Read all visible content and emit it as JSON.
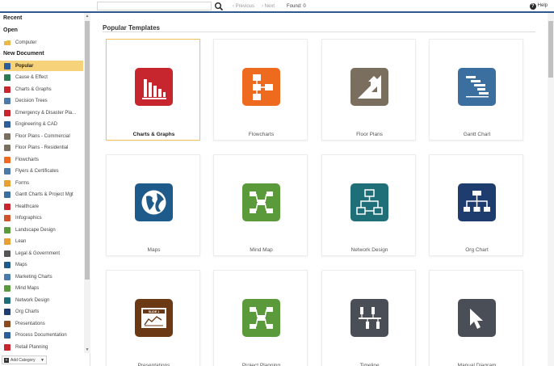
{
  "topbar": {
    "search_value": "",
    "prev_label": "Previous",
    "next_label": "Next",
    "found_label": "Found: 0",
    "help_label": "Help"
  },
  "sidebar": {
    "recent_label": "Recent",
    "open_label": "Open",
    "computer_label": "Computer",
    "new_document_label": "New Document",
    "items": [
      {
        "label": "Popular",
        "color": "#2e5e9a",
        "active": true
      },
      {
        "label": "Cause & Effect",
        "color": "#2b7a55"
      },
      {
        "label": "Charts & Graphs",
        "color": "#c8262e"
      },
      {
        "label": "Decision Trees",
        "color": "#4a7aa7"
      },
      {
        "label": "Emergency & Disaster Pla...",
        "color": "#c8262e"
      },
      {
        "label": "Engineering & CAD",
        "color": "#2e5e9a"
      },
      {
        "label": "Floor Plans - Commercial",
        "color": "#7a6e5e"
      },
      {
        "label": "Floor Plans - Residential",
        "color": "#7a6e5e"
      },
      {
        "label": "Flowcharts",
        "color": "#ee6a1f"
      },
      {
        "label": "Flyers & Certificates",
        "color": "#4a7aa7"
      },
      {
        "label": "Forms",
        "color": "#e8a030"
      },
      {
        "label": "Gantt Charts & Project Mgt",
        "color": "#3a6fa0"
      },
      {
        "label": "Healthcare",
        "color": "#c8262e"
      },
      {
        "label": "Infographics",
        "color": "#d0542a"
      },
      {
        "label": "Landscape Design",
        "color": "#5a9a3a"
      },
      {
        "label": "Lean",
        "color": "#e8a030"
      },
      {
        "label": "Legal & Government",
        "color": "#555555"
      },
      {
        "label": "Maps",
        "color": "#1f5b8a"
      },
      {
        "label": "Marketing Charts",
        "color": "#4a7aa7"
      },
      {
        "label": "Mind Maps",
        "color": "#5a9a3a"
      },
      {
        "label": "Network Design",
        "color": "#1f6f78"
      },
      {
        "label": "Org Charts",
        "color": "#1e3d6e"
      },
      {
        "label": "Presentations",
        "color": "#8a4a1e"
      },
      {
        "label": "Process Documentation",
        "color": "#2e5e9a"
      },
      {
        "label": "Retail Planning",
        "color": "#c8262e"
      }
    ],
    "add_category_label": "Add Category"
  },
  "main": {
    "section_title": "Popular Templates",
    "cards": [
      {
        "label": "Charts & Graphs",
        "icon": "bar-chart-icon",
        "color": "#c8262e",
        "selected": true
      },
      {
        "label": "Flowcharts",
        "icon": "flowchart-icon",
        "color": "#ee6a1f"
      },
      {
        "label": "Floor Plans",
        "icon": "floor-plan-icon",
        "color": "#7a6e5e"
      },
      {
        "label": "Gantt Chart",
        "icon": "gantt-icon",
        "color": "#3a6fa0"
      },
      {
        "label": "Maps",
        "icon": "globe-icon",
        "color": "#1f5b8a"
      },
      {
        "label": "Mind Map",
        "icon": "mind-map-icon",
        "color": "#5a9a3a"
      },
      {
        "label": "Network Design",
        "icon": "network-icon",
        "color": "#1f6f78"
      },
      {
        "label": "Org Chart",
        "icon": "org-chart-icon",
        "color": "#1e3d6e"
      },
      {
        "label": "Presentations",
        "icon": "presentation-icon",
        "color": "#6b3a14"
      },
      {
        "label": "Project Planning",
        "icon": "project-planning-icon",
        "color": "#5a9a3a"
      },
      {
        "label": "Timeline",
        "icon": "timeline-icon",
        "color": "#4a4f57"
      },
      {
        "label": "Manual Diagram",
        "icon": "cursor-icon",
        "color": "#4a4f57"
      }
    ],
    "slide_badge": "SLIDE 1"
  }
}
